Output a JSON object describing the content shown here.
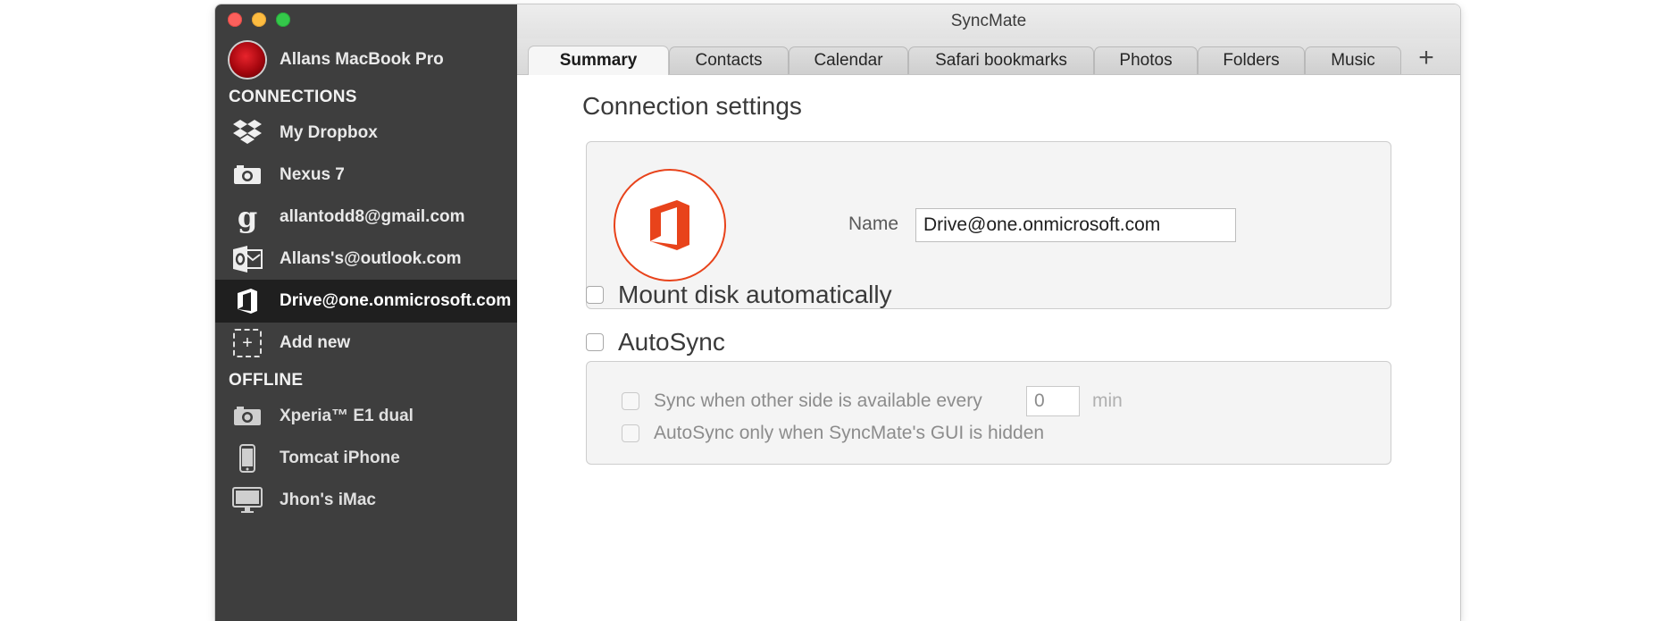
{
  "window": {
    "title": "SyncMate"
  },
  "sidebar": {
    "account": {
      "label": "Allans MacBook Pro",
      "icon": "avatar-icon"
    },
    "connections_header": "CONNECTIONS",
    "connections": [
      {
        "label": "My Dropbox",
        "icon": "dropbox-icon"
      },
      {
        "label": "Nexus 7",
        "icon": "camera-icon"
      },
      {
        "label": "allantodd8@gmail.com",
        "icon": "google-icon"
      },
      {
        "label": "Allans's@outlook.com",
        "icon": "outlook-icon"
      },
      {
        "label": "Drive@one.onmicrosoft.com",
        "icon": "office-icon",
        "selected": true
      },
      {
        "label": "Add new",
        "icon": "add-icon"
      }
    ],
    "offline_header": "OFFLINE",
    "offline": [
      {
        "label": "Xperia™ E1 dual",
        "icon": "camera-icon"
      },
      {
        "label": "Tomcat iPhone",
        "icon": "iphone-icon"
      },
      {
        "label": "Jhon's iMac",
        "icon": "imac-icon"
      }
    ]
  },
  "tabs": [
    {
      "label": "Summary",
      "active": true
    },
    {
      "label": "Contacts"
    },
    {
      "label": "Calendar"
    },
    {
      "label": "Safari bookmarks"
    },
    {
      "label": "Photos"
    },
    {
      "label": "Folders"
    },
    {
      "label": "Music"
    }
  ],
  "tab_add_label": "+",
  "summary": {
    "section_title": "Connection settings",
    "name_label": "Name",
    "name_value": "Drive@one.onmicrosoft.com",
    "mount_label": "Mount disk automatically",
    "mount_checked": false,
    "autosync_label": "AutoSync",
    "autosync_checked": false,
    "sync_every_label": "Sync when other side is available every",
    "sync_every_value": "0",
    "sync_every_unit": "min",
    "gui_hidden_label": "AutoSync only when SyncMate's GUI is hidden"
  },
  "colors": {
    "sidebar_bg": "#3e3e3e",
    "selected_bg": "#1f1f1f",
    "office_accent": "#e8431b"
  }
}
